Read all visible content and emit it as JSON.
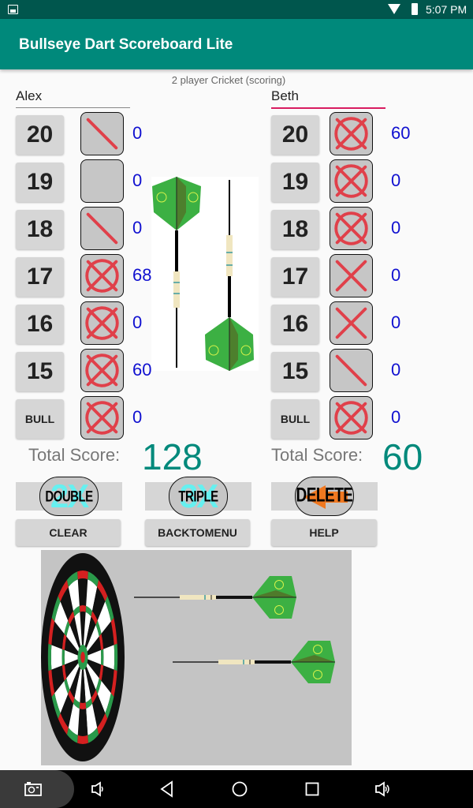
{
  "status_bar": {
    "time": "5:07 PM"
  },
  "app_bar": {
    "title": "Bullseye Dart Scoreboard Lite"
  },
  "game_mode": "2 player Cricket (scoring)",
  "players": [
    {
      "name": "Alex",
      "rows": [
        {
          "number": "20",
          "marks": 1,
          "score": "0"
        },
        {
          "number": "19",
          "marks": 0,
          "score": "0"
        },
        {
          "number": "18",
          "marks": 1,
          "score": "0"
        },
        {
          "number": "17",
          "marks": 3,
          "score": "68"
        },
        {
          "number": "16",
          "marks": 3,
          "score": "0"
        },
        {
          "number": "15",
          "marks": 3,
          "score": "60"
        },
        {
          "number": "BULL",
          "marks": 3,
          "score": "0"
        }
      ],
      "total_label": "Total Score:",
      "total": "128"
    },
    {
      "name": "Beth",
      "rows": [
        {
          "number": "20",
          "marks": 3,
          "score": "60"
        },
        {
          "number": "19",
          "marks": 3,
          "score": "0"
        },
        {
          "number": "18",
          "marks": 3,
          "score": "0"
        },
        {
          "number": "17",
          "marks": 2,
          "score": "0"
        },
        {
          "number": "16",
          "marks": 2,
          "score": "0"
        },
        {
          "number": "15",
          "marks": 1,
          "score": "0"
        },
        {
          "number": "BULL",
          "marks": 3,
          "score": "0"
        }
      ],
      "total_label": "Total Score:",
      "total": "60"
    }
  ],
  "modifiers": {
    "double": {
      "label": "DOUBLE",
      "badge": "2X"
    },
    "triple": {
      "label": "TRIPLE",
      "badge": "3X"
    },
    "delete": {
      "label": "DELETE"
    }
  },
  "buttons": {
    "clear": "CLEAR",
    "back_to_menu": "BACKTOMENU",
    "help": "HELP"
  },
  "colors": {
    "primary": "#00897b",
    "status_bar": "#00564d",
    "accent": "#d81b60",
    "mark": "#e0404a",
    "row_score": "#1010d0",
    "flight_green": "#3cb043"
  },
  "navbar": {
    "icons": [
      "screenshot-icon",
      "volume-down-icon",
      "back-icon",
      "home-icon",
      "recents-icon",
      "volume-up-icon"
    ]
  }
}
